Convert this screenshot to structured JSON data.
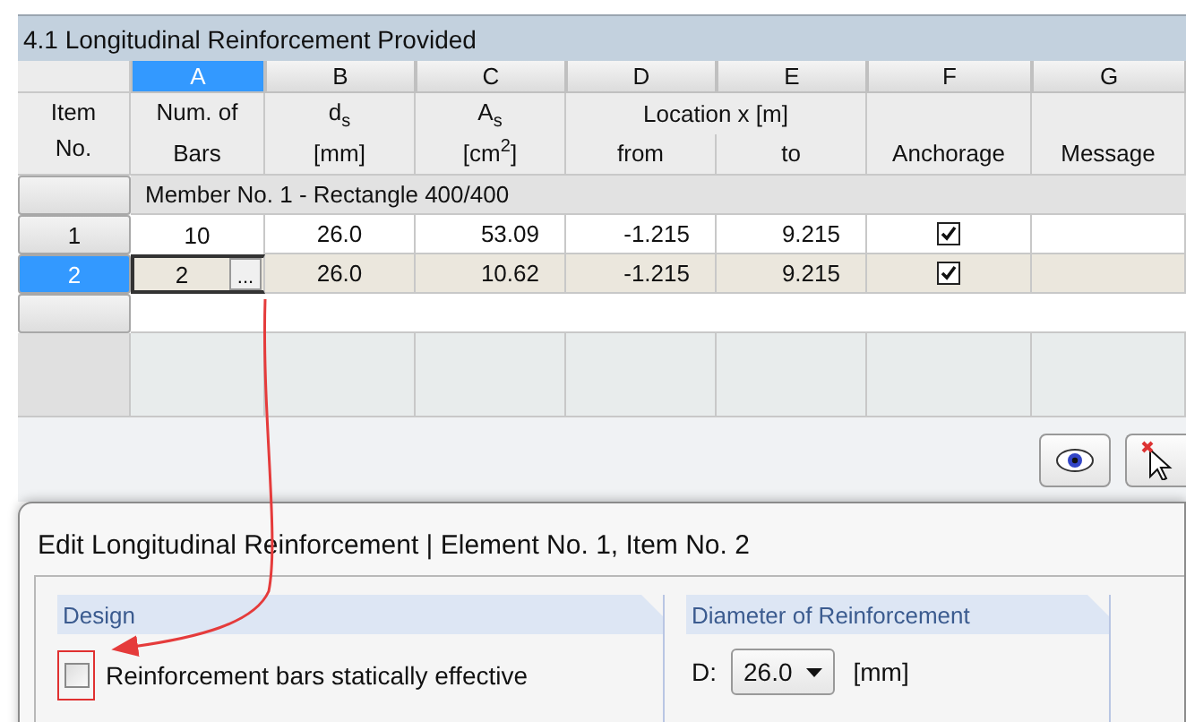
{
  "panel": {
    "title": "4.1 Longitudinal Reinforcement Provided"
  },
  "table": {
    "item_header": [
      "Item",
      "No."
    ],
    "span_header": "Location x [m]",
    "columns": [
      {
        "letter": "A",
        "selected": true,
        "lines": [
          "Num. of",
          "Bars"
        ]
      },
      {
        "letter": "B",
        "selected": false,
        "lines": [
          "d$_{s}$",
          "[mm]"
        ]
      },
      {
        "letter": "C",
        "selected": false,
        "lines": [
          "A$_{s}$",
          "[cm$^{2}$]"
        ]
      },
      {
        "letter": "D",
        "selected": false,
        "lines": [
          "from"
        ]
      },
      {
        "letter": "E",
        "selected": false,
        "lines": [
          "to"
        ]
      },
      {
        "letter": "F",
        "selected": false,
        "lines": [
          "Anchorage"
        ]
      },
      {
        "letter": "G",
        "selected": false,
        "lines": [
          "Message"
        ]
      }
    ],
    "group_row": "Member No. 1 - Rectangle 400/400",
    "rows": [
      {
        "item": "1",
        "selected": false,
        "bars": "10",
        "ds": "26.0",
        "as": "53.09",
        "from": "-1.215",
        "to": "9.215",
        "anchorage": true
      },
      {
        "item": "2",
        "selected": true,
        "bars": "2",
        "edit_button": "...",
        "ds": "26.0",
        "as": "10.62",
        "from": "-1.215",
        "to": "9.215",
        "anchorage": true
      }
    ]
  },
  "dialog": {
    "title": "Edit Longitudinal Reinforcement | Element No. 1, Item No. 2",
    "design": {
      "title": "Design",
      "checkbox": {
        "label": "Reinforcement bars statically effective",
        "checked": false
      }
    },
    "diameter": {
      "title": "Diameter of Reinforcement",
      "label": "D:",
      "value": "26.0",
      "unit": "[mm]"
    }
  }
}
